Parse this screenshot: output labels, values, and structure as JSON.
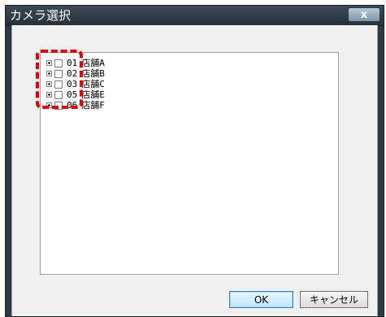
{
  "window": {
    "title": "カメラ選択",
    "close_label": "x"
  },
  "tree": {
    "items": [
      {
        "code": "01",
        "label": "店舗A"
      },
      {
        "code": "02",
        "label": "店舗B"
      },
      {
        "code": "03",
        "label": "店舗C"
      },
      {
        "code": "05",
        "label": "店舗E"
      },
      {
        "code": "06",
        "label": "店舗F"
      }
    ]
  },
  "buttons": {
    "ok": "OK",
    "cancel": "キャンセル"
  },
  "colors": {
    "titlebar": "#2f3a44",
    "highlight": "#e00000",
    "ok_border": "#3c7fb1"
  }
}
